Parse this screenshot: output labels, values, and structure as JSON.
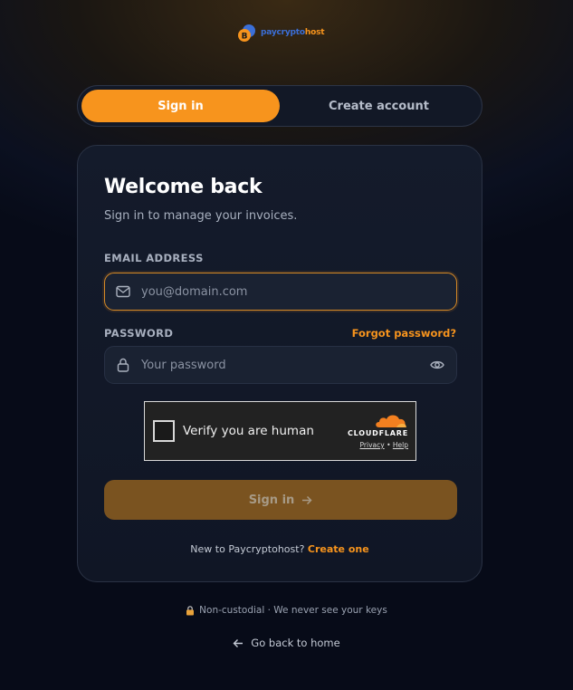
{
  "brand": {
    "name_part1": "paycrypto",
    "name_part2": "host"
  },
  "tabs": [
    {
      "label": "Sign in",
      "active": true
    },
    {
      "label": "Create account",
      "active": false
    }
  ],
  "card": {
    "title": "Welcome back",
    "subtitle": "Sign in to manage your invoices.",
    "email": {
      "label": "EMAIL ADDRESS",
      "placeholder": "you@domain.com",
      "value": ""
    },
    "password": {
      "label": "PASSWORD",
      "placeholder": "Your password",
      "value": "",
      "forgot": "Forgot password?"
    },
    "captcha": {
      "text": "Verify you are human",
      "provider": "CLOUDFLARE",
      "privacy": "Privacy",
      "sep": "•",
      "help": "Help"
    },
    "submit": "Sign in",
    "new_text": "New to Paycryptohost?",
    "new_link": "Create one"
  },
  "footer": {
    "security_note": "Non-custodial · We never see your keys",
    "back_link": "Go back to home"
  },
  "colors": {
    "accent": "#f7941d",
    "background": "#0b1020",
    "card": "#131a2a"
  }
}
